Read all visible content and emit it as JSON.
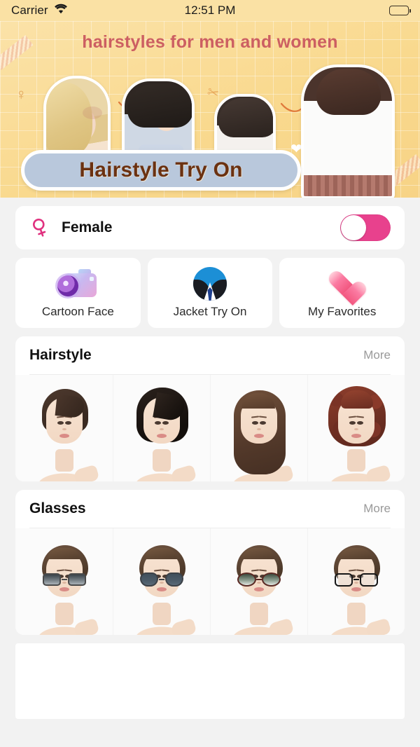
{
  "status_bar": {
    "carrier": "Carrier",
    "wifi_icon": "wifi-icon",
    "time": "12:51 PM",
    "battery_icon": "battery-full-icon"
  },
  "banner": {
    "tagline": "hairstyles for men and women",
    "app_title": "Hairstyle Try On",
    "background_color": "#f9d98e",
    "tagline_color": "#cc5f62",
    "title_pill_color": "#b9c8dc",
    "title_text_color": "#6b3111",
    "decorations": [
      "venus-symbol-doodle",
      "scissors-doodle",
      "swirl-doodle",
      "heart-doodle",
      "washi-tape-doodle"
    ],
    "photos": [
      "blonde-model-photo",
      "grey-tshirt-model-photo",
      "white-top-model-photo",
      "white-sweater-model-photo"
    ]
  },
  "gender_row": {
    "icon": "venus-female-icon",
    "label": "Female",
    "toggle_on": true,
    "toggle_color": "#e8418d",
    "knob_position": "left"
  },
  "features": [
    {
      "id": "cartoon-face",
      "label": "Cartoon Face",
      "icon": "camera-icon"
    },
    {
      "id": "jacket-try-on",
      "label": "Jacket Try On",
      "icon": "suit-avatar-icon"
    },
    {
      "id": "my-favorites",
      "label": "My Favorites",
      "icon": "heart-icon"
    }
  ],
  "sections": [
    {
      "id": "hairstyle",
      "title": "Hairstyle",
      "more_label": "More",
      "items": [
        {
          "id": "hairstyle-1",
          "name": "short-dark-brown-pixie"
        },
        {
          "id": "hairstyle-2",
          "name": "black-layered-bob"
        },
        {
          "id": "hairstyle-3",
          "name": "long-straight-brown"
        },
        {
          "id": "hairstyle-4",
          "name": "auburn-curly-bob"
        }
      ]
    },
    {
      "id": "glasses",
      "title": "Glasses",
      "more_label": "More",
      "items": [
        {
          "id": "glasses-1",
          "name": "square-gradient-sunglasses"
        },
        {
          "id": "glasses-2",
          "name": "aviator-dark-sunglasses"
        },
        {
          "id": "glasses-3",
          "name": "oversized-round-gradient-sunglasses"
        },
        {
          "id": "glasses-4",
          "name": "black-frame-clear-eyeglasses"
        }
      ]
    }
  ],
  "bottom_placeholder": {
    "name": "empty-content-card"
  },
  "theme": {
    "page_background": "#f2f2f2",
    "card_background": "#ffffff",
    "accent_pink": "#e8418d",
    "muted_text": "#999999",
    "primary_text": "#111111"
  }
}
